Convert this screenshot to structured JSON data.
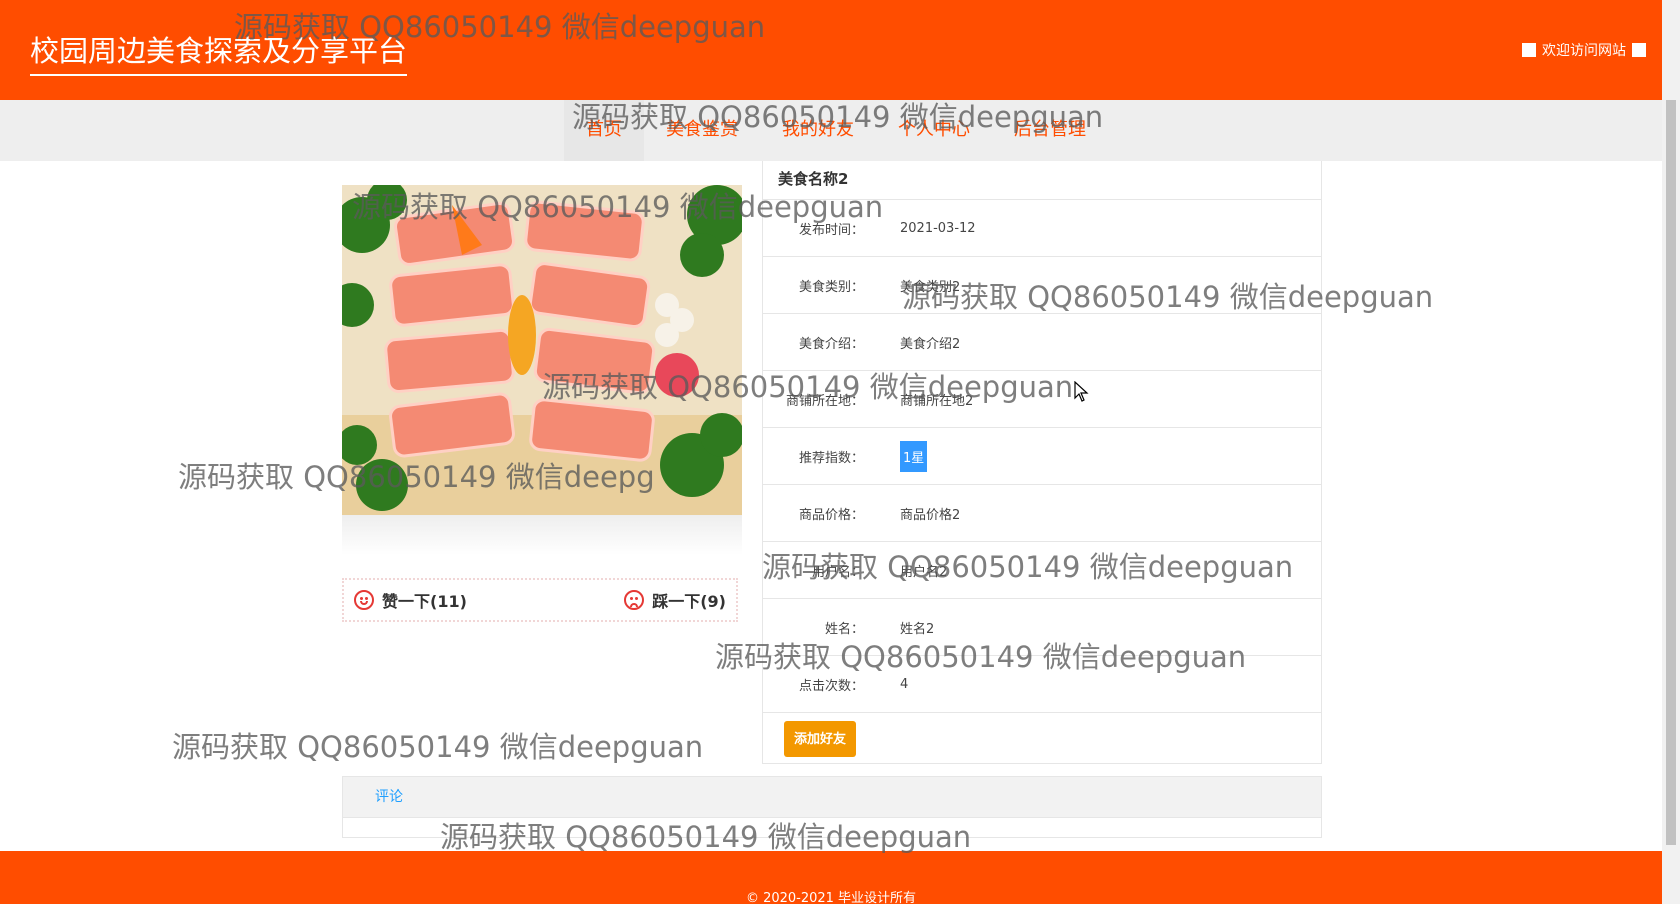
{
  "header": {
    "site_title": "校园周边美食探索及分享平台",
    "welcome": "欢迎访问网站"
  },
  "nav": {
    "items": [
      "首页",
      "美食鉴赏",
      "我的好友",
      "个人中心",
      "后台管理"
    ]
  },
  "food": {
    "image_icon": "salmon-sashimi-photo",
    "like_label": "赞一下(11)",
    "dislike_label": "踩一下(9)",
    "detail_title": "美食名称2",
    "fields": [
      {
        "label": "发布时间：",
        "value": "2021-03-12"
      },
      {
        "label": "美食类别：",
        "value": "美食类别2"
      },
      {
        "label": "美食介绍：",
        "value": "美食介绍2"
      },
      {
        "label": "商铺所在地：",
        "value": "商铺所在地2"
      },
      {
        "label": "推荐指数：",
        "value": "1星"
      },
      {
        "label": "商品价格：",
        "value": "商品价格2"
      },
      {
        "label": "用户名：",
        "value": "用户名2"
      },
      {
        "label": "姓名：",
        "value": "姓名2"
      },
      {
        "label": "点击次数：",
        "value": "4"
      }
    ],
    "add_friend_button": "添加好友"
  },
  "comment": {
    "tab_label": "评论"
  },
  "footer": {
    "copyright": "© 2020-2021 毕业设计所有"
  },
  "watermark": {
    "text": "源码获取 QQ86050149 微信deepguan",
    "partial": "源码获取 QQ86050149 微信deepg"
  },
  "colors": {
    "brand": "#ff4d00",
    "star_badge": "#3399ff",
    "add_button": "#f39800"
  }
}
